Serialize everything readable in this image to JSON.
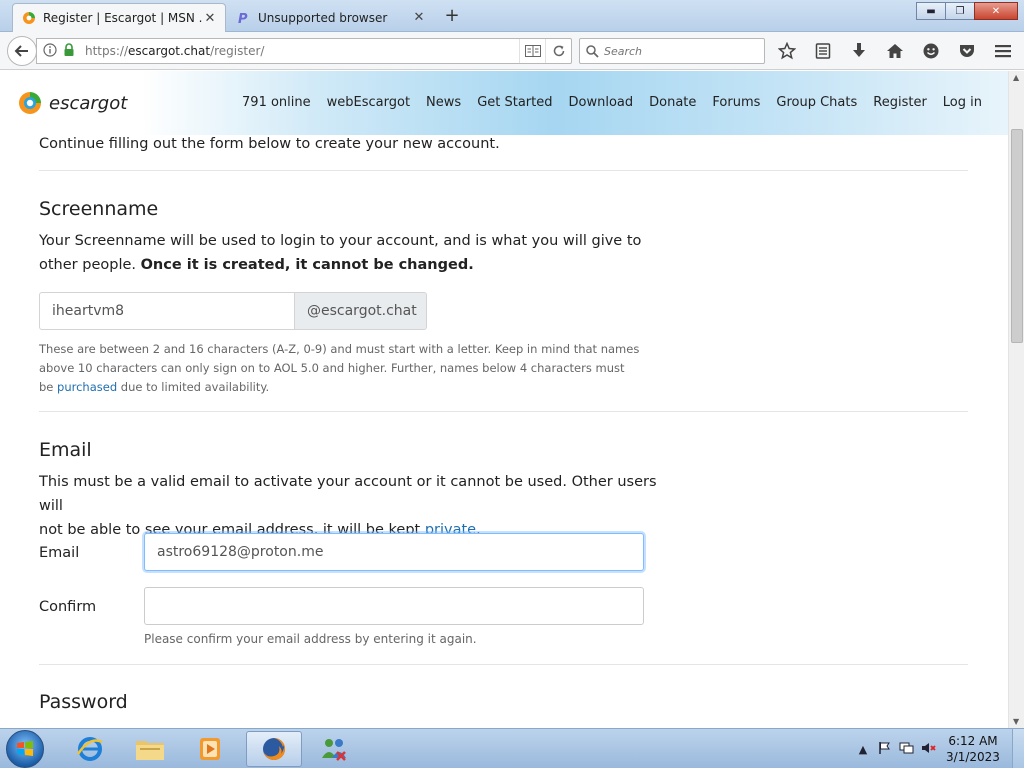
{
  "tabs": [
    {
      "title": "Register | Escargot | MSN ...",
      "close": "✕",
      "active": true
    },
    {
      "title": "Unsupported browser",
      "close": "✕",
      "active": false
    }
  ],
  "new_tab": "+",
  "window_controls": {
    "minimize": "▬",
    "maximize": "❐",
    "close": "✕"
  },
  "address_bar": {
    "url_prefix": "https://",
    "url_host": "escargot.chat",
    "url_path": "/register/"
  },
  "search_bar": {
    "placeholder": "Search"
  },
  "toolbar_icons": [
    "star-icon",
    "reading-list-icon",
    "download-icon",
    "home-icon",
    "smiley-icon",
    "pocket-icon",
    "menu-icon"
  ],
  "site": {
    "logo_text": "escargot",
    "nav": [
      "791 online",
      "webEscargot",
      "News",
      "Get Started",
      "Download",
      "Donate",
      "Forums",
      "Group Chats",
      "Register",
      "Log in"
    ]
  },
  "form": {
    "intro": "Continue filling out the form below to create your new account.",
    "screenname": {
      "heading": "Screenname",
      "desc_line1": "Your Screenname will be used to login to your account, and is what you will give to",
      "desc_line2_plain": "other people. ",
      "desc_line2_bold": "Once it is created, it cannot be changed.",
      "value": "iheartvm8",
      "suffix": "@escargot.chat",
      "help_line1": "These are between 2 and 16 characters (A-Z, 0-9) and must start with a letter. Keep in mind that names",
      "help_line2": "above 10 characters can only sign on to AOL 5.0 and higher. Further, names below 4 characters must",
      "help_line3_pre": "be ",
      "help_link": "purchased",
      "help_line3_post": " due to limited availability."
    },
    "email": {
      "heading": "Email",
      "desc_line1": "This must be a valid email to activate your account or it cannot be used. Other users will",
      "desc_line2_pre": "not be able to see your email address, it will be kept ",
      "desc_link": "private",
      "desc_line2_post": ".",
      "email_label": "Email",
      "email_value": "astro69128@proton.me",
      "confirm_label": "Confirm",
      "confirm_value": "",
      "confirm_help": "Please confirm your email address by entering it again."
    },
    "password": {
      "heading": "Password"
    }
  },
  "taskbar": {
    "items": [
      "internet-explorer-icon",
      "file-explorer-icon",
      "media-player-icon",
      "firefox-icon",
      "network-app-icon"
    ],
    "tray_arrow": "▲",
    "time": "6:12 AM",
    "date": "3/1/2023"
  },
  "colors": {
    "link": "#1f6fb0",
    "focus_border": "#80bdff",
    "logo_orange": "#f7941d",
    "logo_green": "#3aaa35"
  }
}
